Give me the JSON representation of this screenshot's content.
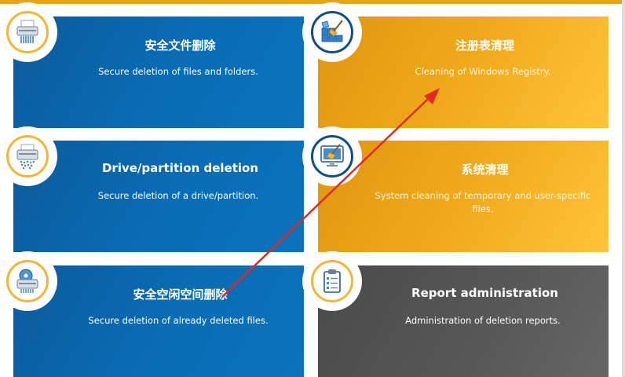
{
  "tiles": [
    {
      "title": "安全文件删除",
      "desc": "Secure deletion of files and folders.",
      "icon": "shredder-icon"
    },
    {
      "title": "注册表清理",
      "desc": "Cleaning of Windows Registry.",
      "icon": "registry-cleaner-icon"
    },
    {
      "title": "Drive/partition deletion",
      "desc": "Secure deletion of a drive/partition.",
      "icon": "drive-shredder-icon"
    },
    {
      "title": "系统清理",
      "desc": "System cleaning of temporary and user-specific files.",
      "icon": "monitor-broom-icon"
    },
    {
      "title": "安全空闲空间删除",
      "desc": "Secure deletion of already deleted files.",
      "icon": "disk-shredder-icon"
    },
    {
      "title": "Report administration",
      "desc": "Administration of deletion reports.",
      "icon": "clipboard-report-icon"
    }
  ],
  "colors": {
    "blue": "#0b6ab3",
    "orange": "#f2aa1c",
    "gray": "#555555",
    "accent": "#e8a316",
    "arrow": "#e02b20"
  }
}
